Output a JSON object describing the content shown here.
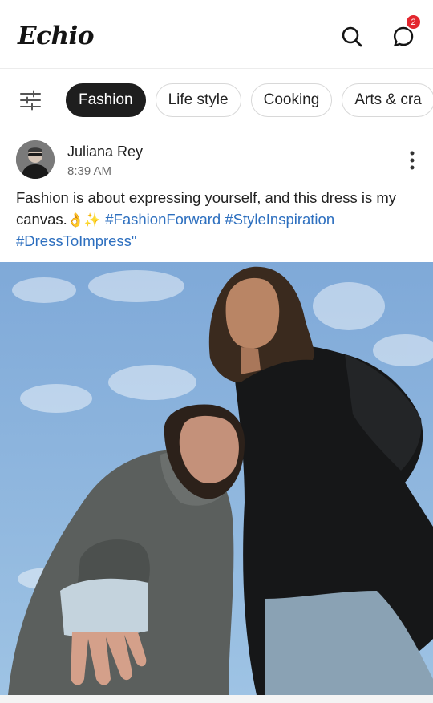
{
  "header": {
    "logo_text": "Echio",
    "search_icon": "search-icon",
    "chat_icon": "chat-icon",
    "notification_count": "2",
    "badge_color": "#e3262e"
  },
  "categories": {
    "filter_icon": "sliders-icon",
    "items": [
      {
        "label": "Fashion",
        "active": true
      },
      {
        "label": "Life style",
        "active": false
      },
      {
        "label": "Cooking",
        "active": false
      },
      {
        "label": "Arts & cra",
        "active": false
      }
    ]
  },
  "post": {
    "author": "Juliana Rey",
    "time": "8:39 AM",
    "caption_text": "Fashion is about expressing yourself, and this dress is my canvas.",
    "caption_emoji": "👌✨",
    "hashtags": [
      "#FashionForward",
      "#StyleInspiration",
      "#DressToImpress\""
    ],
    "hashtag_color": "#2d6fbf",
    "more_icon": "more-vertical-icon",
    "image_subject": "two models in dark coats photographed from below against a blue sky"
  }
}
